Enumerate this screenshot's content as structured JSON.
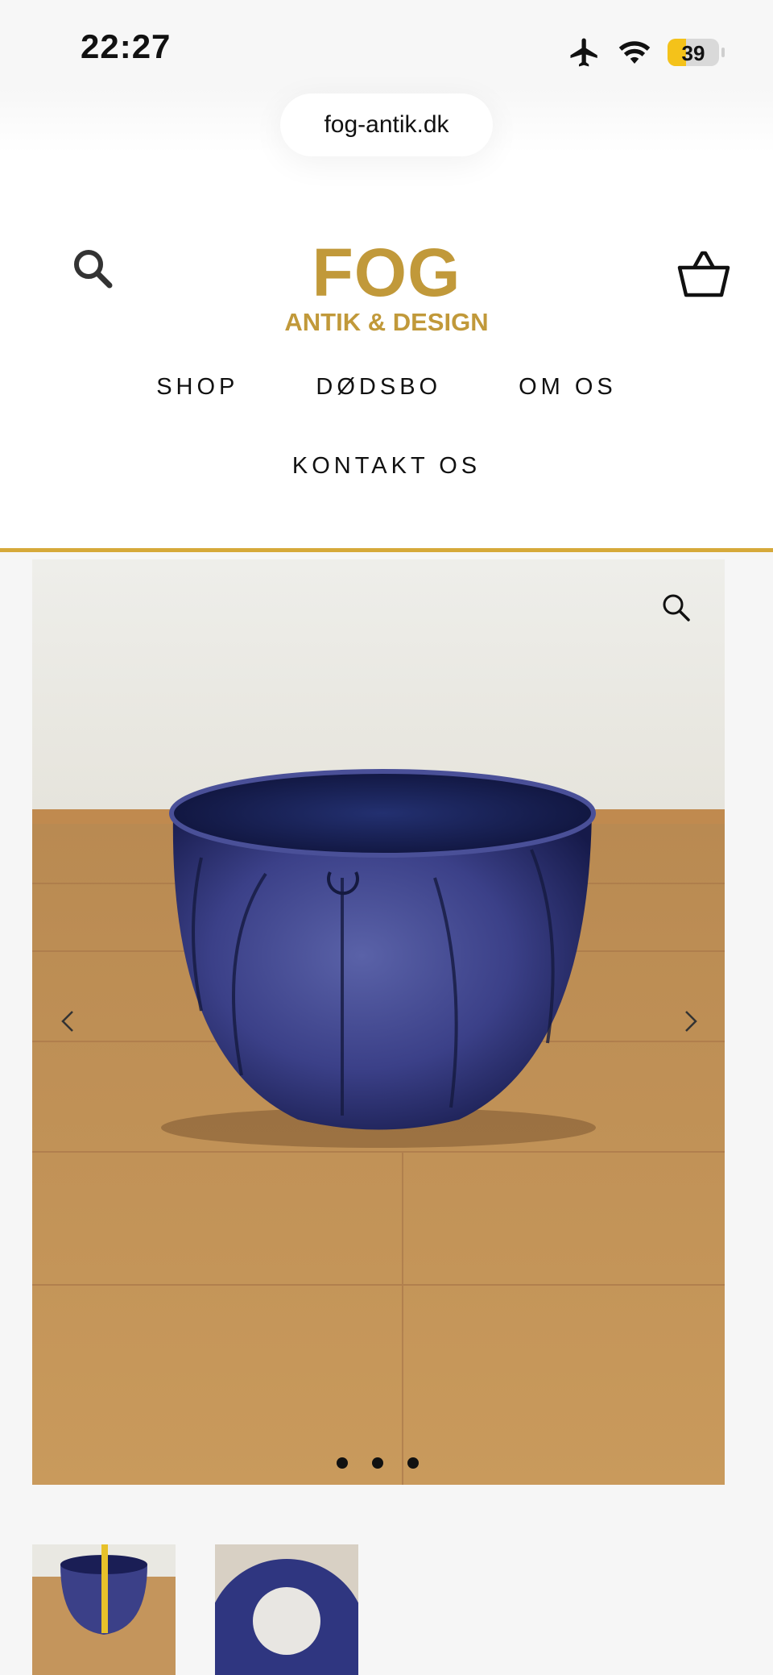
{
  "status_bar": {
    "time": "22:27",
    "battery_level": "39"
  },
  "browser": {
    "url": "fog-antik.dk"
  },
  "logo": {
    "title": "FOG",
    "subtitle": "ANTIK & DESIGN",
    "color": "#c1993a"
  },
  "nav": {
    "items": [
      {
        "label": "SHOP"
      },
      {
        "label": "DØDSBO"
      },
      {
        "label": "OM OS"
      },
      {
        "label": "KONTAKT OS"
      }
    ]
  },
  "colors": {
    "accent": "#d6a93a"
  },
  "icons": [
    "search-icon",
    "basket-icon",
    "zoom-icon",
    "chevron-left-icon",
    "chevron-right-icon",
    "airplane-icon",
    "wifi-icon"
  ],
  "gallery": {
    "slide_count": 3
  }
}
